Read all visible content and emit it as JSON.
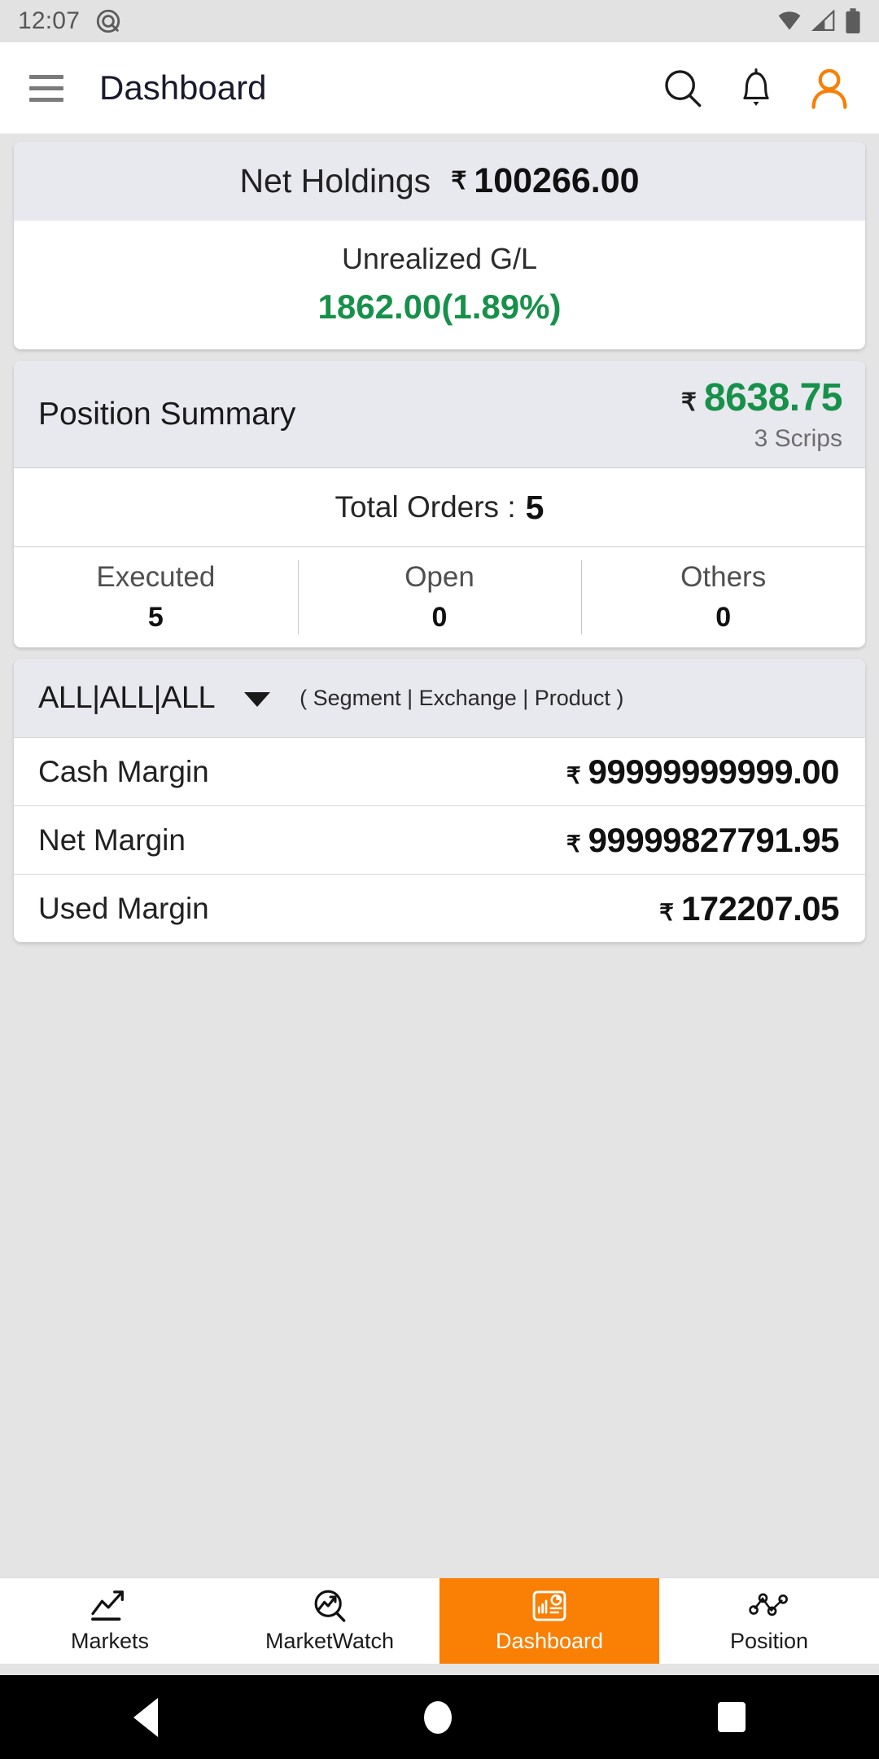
{
  "statusbar": {
    "clock": "12:07",
    "icons": [
      "do-not-disturb-icon",
      "wifi-icon",
      "signal-icon",
      "battery-icon"
    ]
  },
  "appbar": {
    "menu_icon": "hamburger-menu-icon",
    "title": "Dashboard",
    "search_icon": "search-icon",
    "notification_icon": "bell-icon",
    "profile_icon": "user-profile-icon",
    "accent": "#f97f05"
  },
  "net_holdings": {
    "label": "Net Holdings",
    "currency": "₹",
    "value": "100266.00",
    "unrealized_label": "Unrealized G/L",
    "unrealized_value": "1862.00(1.89%)",
    "gain_color": "#17914a"
  },
  "position_summary": {
    "title": "Position Summary",
    "currency": "₹",
    "amount": "8638.75",
    "scrips": "3 Scrips",
    "gain_color": "#17914a",
    "total_orders_label": "Total Orders :",
    "total_orders_value": "5",
    "breakdown": [
      {
        "label": "Executed",
        "value": "5"
      },
      {
        "label": "Open",
        "value": "0"
      },
      {
        "label": "Others",
        "value": "0"
      }
    ]
  },
  "margin": {
    "filter_value": "ALL|ALL|ALL",
    "filter_caret_icon": "chevron-down-icon",
    "filter_hint": "( Segment | Exchange | Product )",
    "rows": [
      {
        "label": "Cash Margin",
        "currency": "₹",
        "value": "99999999999.00"
      },
      {
        "label": "Net Margin",
        "currency": "₹",
        "value": "99999827791.95"
      },
      {
        "label": "Used Margin",
        "currency": "₹",
        "value": "172207.05"
      }
    ]
  },
  "bottom_nav": {
    "active_color": "#f97f05",
    "items": [
      {
        "label": "Markets",
        "icon": "trending-up-chart-icon",
        "active": false
      },
      {
        "label": "MarketWatch",
        "icon": "chart-magnifier-icon",
        "active": false
      },
      {
        "label": "Dashboard",
        "icon": "dashboard-report-icon",
        "active": true
      },
      {
        "label": "Position",
        "icon": "scatter-nodes-icon",
        "active": false
      }
    ]
  },
  "system_nav": {
    "back": "back-triangle-icon",
    "home": "home-circle-icon",
    "recent": "recent-square-icon"
  }
}
